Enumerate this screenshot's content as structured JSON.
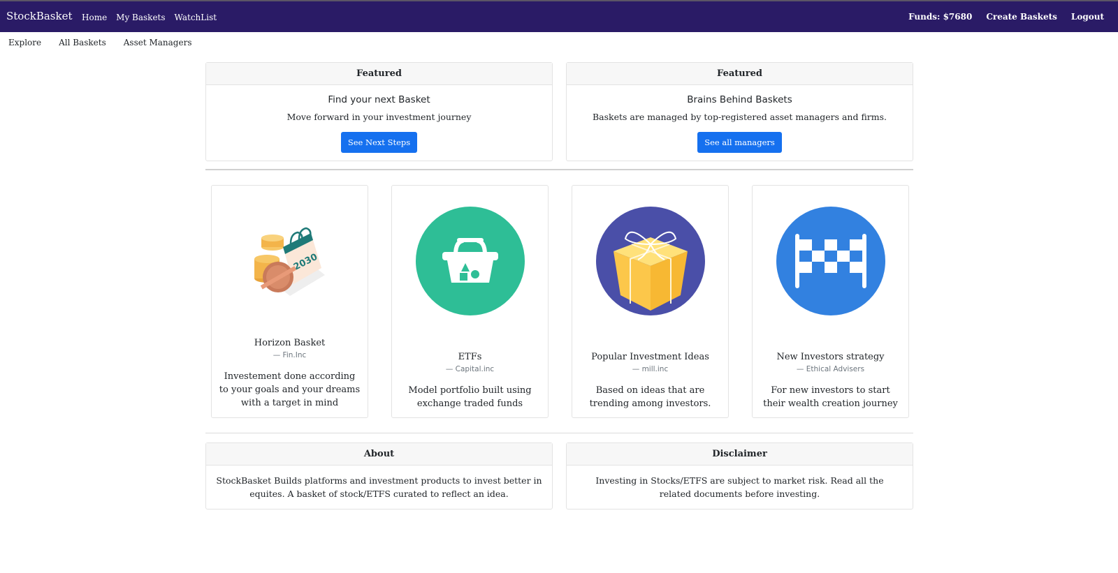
{
  "navbar": {
    "brand": "StockBasket",
    "links": [
      "Home",
      "My Baskets",
      "WatchList"
    ],
    "funds": "Funds: $7680",
    "create": "Create Baskets",
    "logout": "Logout"
  },
  "subnav": [
    "Explore",
    "All Baskets",
    "Asset Managers"
  ],
  "featured": [
    {
      "header": "Featured",
      "title": "Find your next Basket",
      "text": "Move forward in your investment journey",
      "button": "See Next Steps"
    },
    {
      "header": "Featured",
      "title": "Brains Behind Baskets",
      "text": "Baskets are managed by top-registered asset managers and firms.",
      "button": "See all managers"
    }
  ],
  "baskets": [
    {
      "title": "Horizon Basket",
      "source": "— Fin.Inc",
      "description": "Investement done according to your goals and your dreams with a target in mind",
      "icon": "calendar-coins-icon"
    },
    {
      "title": "ETFs",
      "source": "— Capital.inc",
      "description": "Model portfolio built using exchange traded funds",
      "icon": "basket-icon",
      "color": "#2ebe96"
    },
    {
      "title": "Popular Investment Ideas",
      "source": "— mill.inc",
      "description": "Based on ideas that are trending among investors.",
      "icon": "gift-box-icon",
      "color": "#4a4fa8"
    },
    {
      "title": "New Investors strategy",
      "source": "— Ethical Advisers",
      "description": "For new investors to start their wealth creation journey",
      "icon": "finish-flag-icon",
      "color": "#3281e0"
    }
  ],
  "about": {
    "header": "About",
    "text": "StockBasket Builds platforms and investment products to invest better in equites. A basket of stock/ETFS curated to reflect an idea."
  },
  "disclaimer": {
    "header": "Disclaimer",
    "text": "Investing in Stocks/ETFS are subject to market risk. Read all the related documents before investing."
  },
  "colors": {
    "navbar": "#2a1b66",
    "primary_button": "#1570ef"
  }
}
